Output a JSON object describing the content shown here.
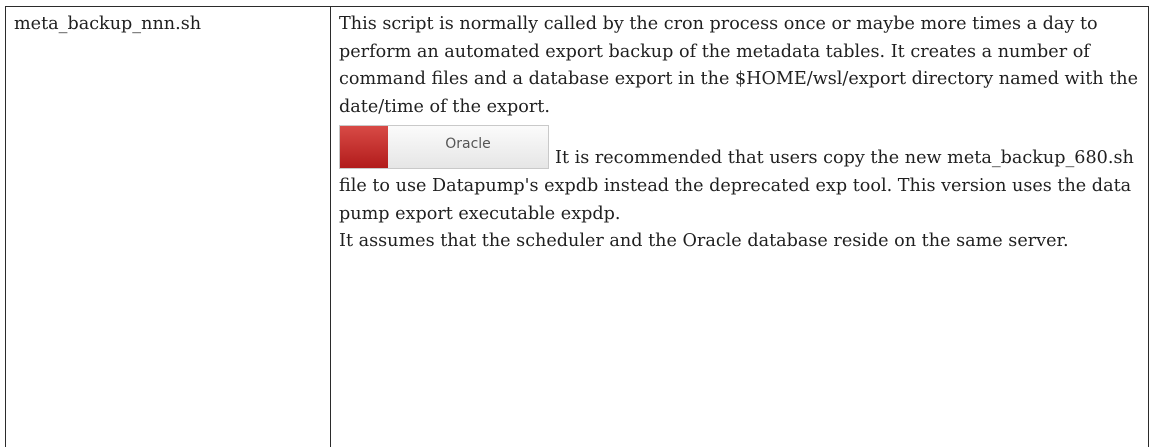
{
  "row": {
    "script_name": "meta_backup_nnn.sh",
    "description": "This script is normally called by the cron process once or maybe more times a day to perform an automated export backup of the metadata tables. It creates a number of command files and a database export in the $HOME/wsl/export directory named with the date/time of the export.",
    "badge": {
      "label": "Oracle",
      "swatch_color": "#c62a2a"
    },
    "note_1": "It is recommended that users copy the new meta_backup_680.sh file to use Datapump's expdb instead the deprecated exp tool. This version uses the data pump export executable expdp.",
    "note_2": "It assumes that the scheduler and the Oracle database reside on the same server."
  }
}
